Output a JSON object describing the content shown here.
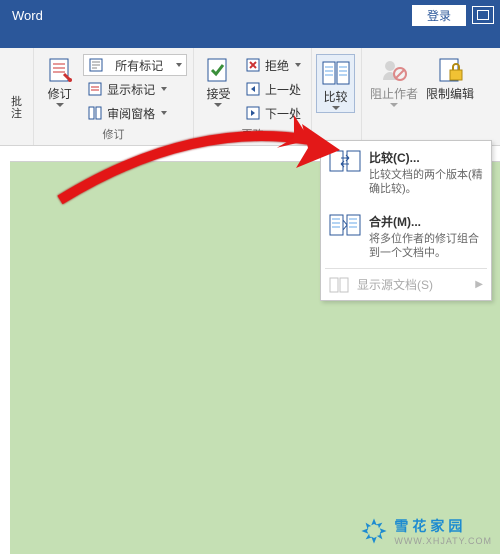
{
  "titlebar": {
    "app_name": "Word",
    "login_btn": "登录"
  },
  "ribbon": {
    "group_comments": {
      "button_label": "批注"
    },
    "group_tracking": {
      "track_changes_label": "修订",
      "all_markup_label": "所有标记",
      "show_markup_label": "显示标记",
      "reviewing_pane_label": "审阅窗格",
      "group_label": "修订"
    },
    "group_changes": {
      "accept_label": "接受",
      "reject_label": "拒绝",
      "previous_label": "上一处",
      "next_label": "下一处",
      "group_label": "更改"
    },
    "group_compare": {
      "compare_label": "比较"
    },
    "group_protect": {
      "block_authors_label": "阻止作者",
      "restrict_editing_label": "限制编辑"
    }
  },
  "dropdown": {
    "compare": {
      "title": "比较(C)...",
      "desc": "比较文档的两个版本(精确比较)。"
    },
    "merge": {
      "title": "合并(M)...",
      "desc": "将多位作者的修订组合到一个文档中。"
    },
    "show_source": {
      "label": "显示源文档(S)"
    }
  },
  "watermark": {
    "cn": "雪花家园",
    "en": "WWW.XHJATY.COM"
  }
}
